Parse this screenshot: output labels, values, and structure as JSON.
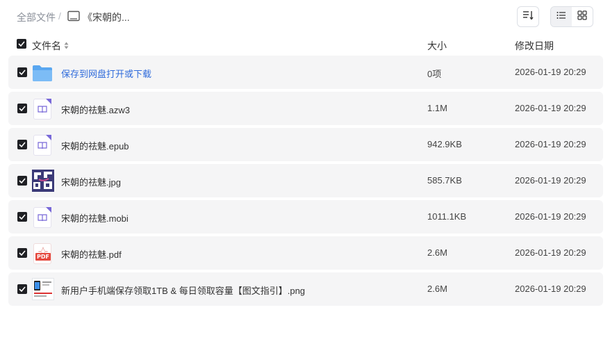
{
  "breadcrumb": {
    "root": "全部文件",
    "separator": "/",
    "current": "《宋朝的..."
  },
  "toolbar": {
    "sort_icon": "sort-icon",
    "list_view_icon": "list-view-icon",
    "grid_view_icon": "grid-view-icon",
    "active_view": "list"
  },
  "columns": {
    "name": "文件名",
    "size": "大小",
    "date": "修改日期"
  },
  "files": [
    {
      "name": "保存到网盘打开或下载",
      "size": "0项",
      "date": "2026-01-19 20:29",
      "type": "folder"
    },
    {
      "name": "宋朝的祛魅.azw3",
      "size": "1.1M",
      "date": "2026-01-19 20:29",
      "type": "ebook"
    },
    {
      "name": "宋朝的祛魅.epub",
      "size": "942.9KB",
      "date": "2026-01-19 20:29",
      "type": "ebook"
    },
    {
      "name": "宋朝的祛魅.jpg",
      "size": "585.7KB",
      "date": "2026-01-19 20:29",
      "type": "image"
    },
    {
      "name": "宋朝的祛魅.mobi",
      "size": "1011.1KB",
      "date": "2026-01-19 20:29",
      "type": "ebook"
    },
    {
      "name": "宋朝的祛魅.pdf",
      "size": "2.6M",
      "date": "2026-01-19 20:29",
      "type": "pdf"
    },
    {
      "name": "新用户手机端保存领取1TB & 每日领取容量【图文指引】.png",
      "size": "2.6M",
      "date": "2026-01-19 20:29",
      "type": "png"
    }
  ],
  "pdf_label": "PDF",
  "colors": {
    "folder": "#5aa7f0",
    "ebook_accent": "#7868d8",
    "link": "#2f6bdb",
    "row_bg": "#f5f5f6",
    "checkbox": "#1f2024"
  }
}
